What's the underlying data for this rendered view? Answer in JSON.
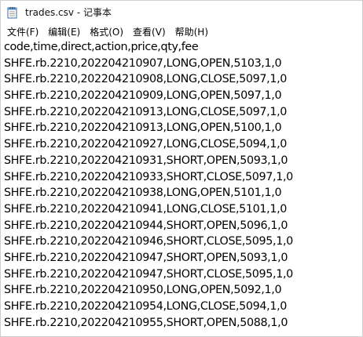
{
  "window": {
    "title": "trades.csv - 记事本"
  },
  "menu": [
    {
      "label": "文件(F)"
    },
    {
      "label": "编辑(E)"
    },
    {
      "label": "格式(O)"
    },
    {
      "label": "查看(V)"
    },
    {
      "label": "帮助(H)"
    }
  ],
  "document": {
    "lines": [
      "code,time,direct,action,price,qty,fee",
      "SHFE.rb.2210,202204210907,LONG,OPEN,5103,1,0",
      "SHFE.rb.2210,202204210908,LONG,CLOSE,5097,1,0",
      "SHFE.rb.2210,202204210909,LONG,OPEN,5097,1,0",
      "SHFE.rb.2210,202204210913,LONG,CLOSE,5097,1,0",
      "SHFE.rb.2210,202204210913,LONG,OPEN,5100,1,0",
      "SHFE.rb.2210,202204210927,LONG,CLOSE,5094,1,0",
      "SHFE.rb.2210,202204210931,SHORT,OPEN,5093,1,0",
      "SHFE.rb.2210,202204210933,SHORT,CLOSE,5097,1,0",
      "SHFE.rb.2210,202204210938,LONG,OPEN,5101,1,0",
      "SHFE.rb.2210,202204210941,LONG,CLOSE,5101,1,0",
      "SHFE.rb.2210,202204210944,SHORT,OPEN,5096,1,0",
      "SHFE.rb.2210,202204210946,SHORT,CLOSE,5095,1,0",
      "SHFE.rb.2210,202204210947,SHORT,OPEN,5093,1,0",
      "SHFE.rb.2210,202204210947,SHORT,CLOSE,5095,1,0",
      "SHFE.rb.2210,202204210950,LONG,OPEN,5092,1,0",
      "SHFE.rb.2210,202204210954,LONG,CLOSE,5094,1,0",
      "SHFE.rb.2210,202204210955,SHORT,OPEN,5088,1,0"
    ]
  },
  "icons": {
    "app": "notepad-icon"
  }
}
